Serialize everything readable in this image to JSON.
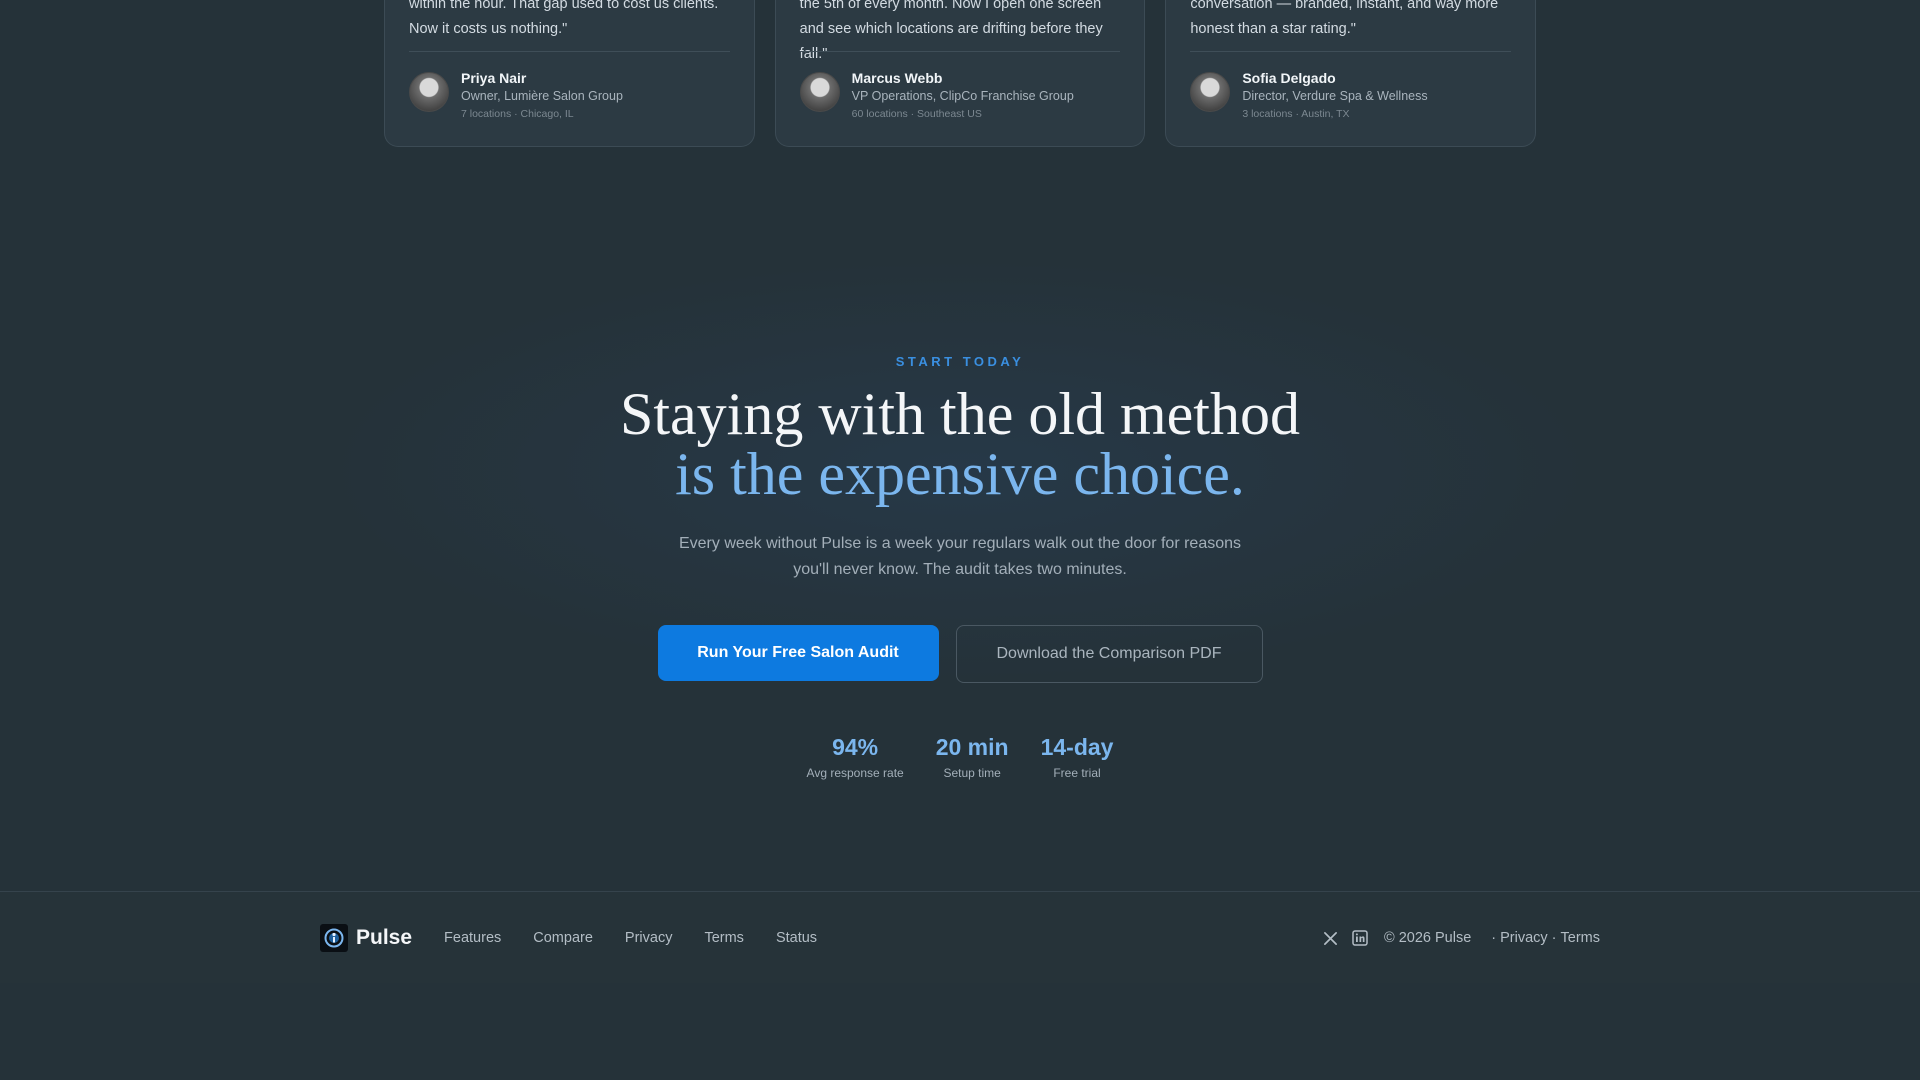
{
  "testimonials": [
    {
      "quote": "within the hour. That gap used to cost us clients. Now it costs us nothing.\"",
      "name": "Priya Nair",
      "role": "Owner, Lumière Salon Group",
      "meta": "7 locations · Chicago, IL"
    },
    {
      "quote": "the 5th of every month. Now I open one screen and see which locations are drifting before they fall.\"",
      "name": "Marcus Webb",
      "role": "VP Operations, ClipCo Franchise Group",
      "meta": "60 locations · Southeast US"
    },
    {
      "quote": "conversation — branded, instant, and way more honest than a star rating.\"",
      "name": "Sofia Delgado",
      "role": "Director, Verdure Spa & Wellness",
      "meta": "3 locations · Austin, TX"
    }
  ],
  "cta": {
    "eyebrow": "START TODAY",
    "headline_line1": "Staying with the old method",
    "headline_line2": "is the expensive choice.",
    "subtext": "Every week without Pulse is a week your regulars walk out the door for reasons you'll never know. The audit takes two minutes.",
    "primary_button": "Run Your Free Salon Audit",
    "secondary_button": "Download the Comparison PDF",
    "stats": [
      {
        "value": "94%",
        "label": "Avg response rate"
      },
      {
        "value": "20 min",
        "label": "Setup time"
      },
      {
        "value": "14-day",
        "label": "Free trial"
      }
    ]
  },
  "footer": {
    "logo_text": "Pulse",
    "links": [
      "Features",
      "Compare",
      "Privacy",
      "Terms",
      "Status"
    ],
    "copyright": "© 2026 Pulse",
    "legal_sep1": "·",
    "legal_privacy": "Privacy",
    "legal_sep2": "·",
    "legal_terms": "Terms"
  },
  "colors": {
    "background": "#253239",
    "accent": "#0d7ae0",
    "accent_light": "#7bb6ee",
    "eyebrow": "#3a8fe0"
  },
  "icons": [
    "x-icon",
    "linkedin-icon",
    "pulse-logo-icon"
  ]
}
